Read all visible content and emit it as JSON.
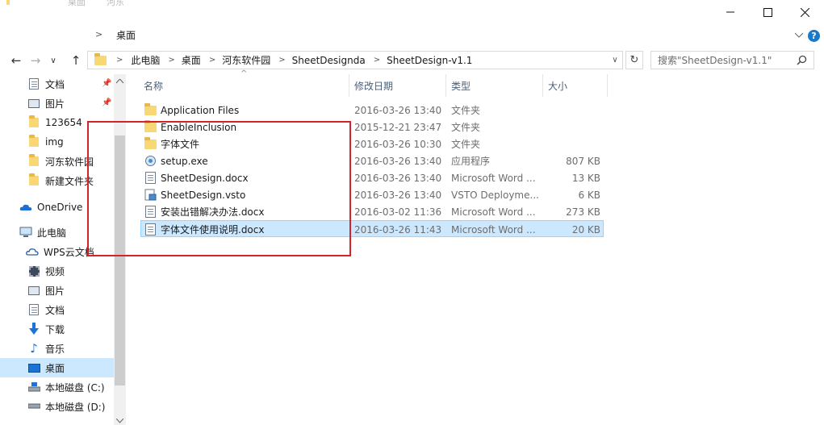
{
  "window": {
    "ghost_title_1": "桌面",
    "ghost_title_2": "河东",
    "minimize_icon": "minimize-icon",
    "maximize_icon": "maximize-icon",
    "close_icon": "close-icon"
  },
  "ribbon": {
    "breadcrumb_sep": ">",
    "breadcrumb_label": "桌面",
    "expand_icon": "chevron-down-icon",
    "help_label": "?"
  },
  "nav_buttons": {
    "back": "←",
    "forward": "→",
    "recent": "∨",
    "up": "↑"
  },
  "address": {
    "crumbs": [
      "此电脑",
      "桌面",
      "河东软件园",
      "SheetDesignda",
      "SheetDesign-v1.1"
    ],
    "separator": ">",
    "dropdown": "∨",
    "refresh": "↻"
  },
  "search": {
    "placeholder": "搜索\"SheetDesign-v1.1\""
  },
  "nav_pane": {
    "items": [
      {
        "label": "文档",
        "icon": "document-icon",
        "pinned": true
      },
      {
        "label": "图片",
        "icon": "pictures-icon",
        "pinned": true
      },
      {
        "label": "123654",
        "icon": "folder-icon"
      },
      {
        "label": "img",
        "icon": "folder-icon"
      },
      {
        "label": "河东软件园",
        "icon": "folder-icon"
      },
      {
        "label": "新建文件夹",
        "icon": "folder-icon"
      },
      {
        "label": "OneDrive",
        "icon": "onedrive-icon"
      },
      {
        "label": "此电脑",
        "icon": "computer-icon"
      },
      {
        "label": "WPS云文档",
        "icon": "cloud-icon"
      },
      {
        "label": "视频",
        "icon": "video-icon"
      },
      {
        "label": "图片",
        "icon": "pictures-icon"
      },
      {
        "label": "文档",
        "icon": "document-icon"
      },
      {
        "label": "下载",
        "icon": "download-icon"
      },
      {
        "label": "音乐",
        "icon": "music-icon"
      },
      {
        "label": "桌面",
        "icon": "desktop-icon",
        "selected": true
      },
      {
        "label": "本地磁盘 (C:)",
        "icon": "drive-icon"
      },
      {
        "label": "本地磁盘 (D:)",
        "icon": "drive-icon"
      }
    ]
  },
  "columns": {
    "name": "名称",
    "date": "修改日期",
    "type": "类型",
    "size": "大小",
    "sort_indicator": "^"
  },
  "files": [
    {
      "name": "Application Files",
      "date": "2016-03-26 13:40",
      "type": "文件夹",
      "size": "",
      "icon": "folder-icon"
    },
    {
      "name": "EnableInclusion",
      "date": "2015-12-21 23:47",
      "type": "文件夹",
      "size": "",
      "icon": "folder-icon"
    },
    {
      "name": "字体文件",
      "date": "2016-03-26 10:30",
      "type": "文件夹",
      "size": "",
      "icon": "folder-icon"
    },
    {
      "name": "setup.exe",
      "date": "2016-03-26 13:40",
      "type": "应用程序",
      "size": "807 KB",
      "icon": "setup-icon"
    },
    {
      "name": "SheetDesign.docx",
      "date": "2016-03-26 13:40",
      "type": "Microsoft Word ...",
      "size": "13 KB",
      "icon": "word-document-icon"
    },
    {
      "name": "SheetDesign.vsto",
      "date": "2016-03-26 13:40",
      "type": "VSTO Deployme...",
      "size": "6 KB",
      "icon": "vsto-icon"
    },
    {
      "name": "安装出错解决办法.docx",
      "date": "2016-03-02 11:36",
      "type": "Microsoft Word ...",
      "size": "273 KB",
      "icon": "word-document-icon"
    },
    {
      "name": "字体文件使用说明.docx",
      "date": "2016-03-26 11:43",
      "type": "Microsoft Word ...",
      "size": "20 KB",
      "icon": "word-document-icon",
      "selected": true
    }
  ],
  "colors": {
    "selection": "#cce8ff",
    "highlight_box": "#d3242c",
    "folder": "#f8d775",
    "header_text": "#4c607a"
  }
}
